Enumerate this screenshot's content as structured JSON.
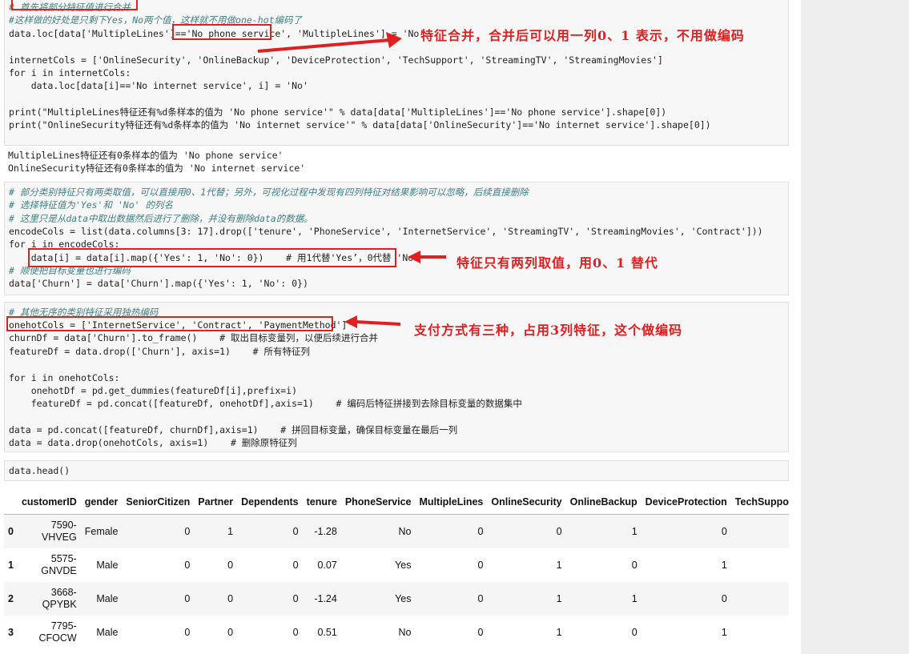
{
  "cell1": {
    "lines": [
      "# 首先将部分特征值进行合并",
      "#这样做的好处是只剩下Yes，No两个值，这样就不用做one-hot编码了",
      "data.loc[data['MultipleLines']=='No phone service', 'MultipleLines'] = 'No'",
      "",
      "internetCols = ['OnlineSecurity', 'OnlineBackup', 'DeviceProtection', 'TechSupport', 'StreamingTV', 'StreamingMovies']",
      "for i in internetCols:",
      "    data.loc[data[i]=='No internet service', i] = 'No'",
      "",
      "print(\"MultipleLines特征还有%d条样本的值为 'No phone service'\" % data[data['MultipleLines']=='No phone service'].shape[0])",
      "print(\"OnlineSecurity特征还有%d条样本的值为 'No internet service'\" % data[data['OnlineSecurity']=='No internet service'].shape[0])"
    ]
  },
  "output1": {
    "lines": [
      "MultipleLines特征还有0条样本的值为 'No phone service'",
      "OnlineSecurity特征还有0条样本的值为 'No internet service'"
    ]
  },
  "cell2": {
    "lines": [
      "# 部分类别特征只有两类取值，可以直接用0、1代替；另外，可视化过程中发现有四列特征对结果影响可以忽略，后续直接删除",
      "# 选择特征值为'Yes'和 'No' 的列名",
      "# 这里只是从data中取出数据然后进行了删除，并没有删除data的数据。",
      "encodeCols = list(data.columns[3: 17].drop(['tenure', 'PhoneService', 'InternetService', 'StreamingTV', 'StreamingMovies', 'Contract']))",
      "for i in encodeCols:",
      "    data[i] = data[i].map({'Yes': 1, 'No': 0})    # 用1代替'Yes’，0代替 'No'",
      "# 顺便把目标变量也进行编码",
      "data['Churn'] = data['Churn'].map({'Yes': 1, 'No': 0})"
    ]
  },
  "cell3": {
    "lines": [
      "# 其他无序的类别特征采用独热编码",
      "onehotCols = ['InternetService', 'Contract', 'PaymentMethod']",
      "churnDf = data['Churn'].to_frame()    # 取出目标变量列，以便后续进行合并",
      "featureDf = data.drop(['Churn'], axis=1)    # 所有特征列",
      "",
      "for i in onehotCols:",
      "    onehotDf = pd.get_dummies(featureDf[i],prefix=i)",
      "    featureDf = pd.concat([featureDf, onehotDf],axis=1)    # 编码后特征拼接到去除目标变量的数据集中",
      "",
      "data = pd.concat([featureDf, churnDf],axis=1)    # 拼回目标变量，确保目标变量在最后一列",
      "data = data.drop(onehotCols, axis=1)    # 删除原特征列"
    ]
  },
  "cell4": {
    "lines": [
      "data.head()"
    ]
  },
  "annotations": {
    "note1": "特征合并，合并后可以用一列0、1 表示，不用做编码",
    "note2": "特征只有两列取值，用0、1 替代",
    "note3": "支付方式有三种，占用3列特征，这个做编码"
  },
  "table": {
    "columns": [
      "",
      "customerID",
      "gender",
      "SeniorCitizen",
      "Partner",
      "Dependents",
      "tenure",
      "PhoneService",
      "MultipleLines",
      "OnlineSecurity",
      "OnlineBackup",
      "DeviceProtection",
      "TechSuppo"
    ],
    "rows": [
      [
        "0",
        "7590-\nVHVEG",
        "Female",
        "0",
        "1",
        "0",
        "-1.28",
        "No",
        "0",
        "0",
        "1",
        "0",
        ""
      ],
      [
        "1",
        "5575-\nGNVDE",
        "Male",
        "0",
        "0",
        "0",
        "0.07",
        "Yes",
        "0",
        "1",
        "0",
        "1",
        ""
      ],
      [
        "2",
        "3668-\nQPYBK",
        "Male",
        "0",
        "0",
        "0",
        "-1.24",
        "Yes",
        "0",
        "1",
        "1",
        "0",
        ""
      ],
      [
        "3",
        "7795-\nCFOCW",
        "Male",
        "0",
        "0",
        "0",
        "0.51",
        "No",
        "0",
        "1",
        "0",
        "1",
        ""
      ]
    ]
  },
  "colors": {
    "accent": "#e02020",
    "comment": "#408080",
    "string": "#ba2121",
    "keyword": "#008000"
  }
}
